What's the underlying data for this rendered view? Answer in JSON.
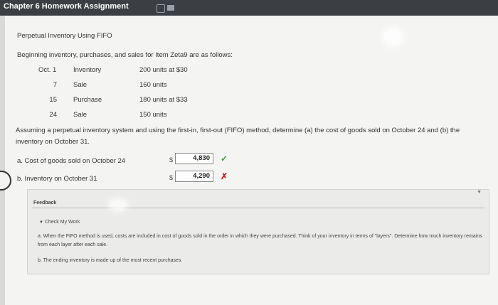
{
  "window": {
    "title": "Chapter 6 Homework Assignment"
  },
  "problem": {
    "heading": "Perpetual Inventory Using FIFO",
    "intro": "Beginning inventory, purchases, and sales for Item Zeta9 are as follows:",
    "transactions": [
      {
        "date": "Oct. 1",
        "type": "Inventory",
        "detail": "200 units at $30"
      },
      {
        "date": "7",
        "type": "Sale",
        "detail": "160 units"
      },
      {
        "date": "15",
        "type": "Purchase",
        "detail": "180 units at $33"
      },
      {
        "date": "24",
        "type": "Sale",
        "detail": "150 units"
      }
    ],
    "question": "Assuming a perpetual inventory system and using the first-in, first-out (FIFO) method, determine (a) the cost of goods sold on October 24 and (b) the inventory on October 31."
  },
  "answers": [
    {
      "label": "a. Cost of goods sold on October 24",
      "currency": "$",
      "value": "4,830",
      "status": "correct"
    },
    {
      "label": "b. Inventory on October 31",
      "currency": "$",
      "value": "4,290",
      "status": "incorrect"
    }
  ],
  "feedback": {
    "header": "Feedback",
    "check_my_work": "Check My Work",
    "hint_a": "a. When the FIFO method is used, costs are included in cost of goods sold in the order in which they were purchased. Think of your inventory in terms of \"layers\". Determine how much inventory remains from each layer after each sale.",
    "hint_b": "b. The ending inventory is made up of the most recent purchases."
  },
  "icons": {
    "correct": "✓",
    "incorrect": "✗",
    "collapse": "▼",
    "expanded": "▼"
  },
  "colors": {
    "topbar": "#3b3f44",
    "correct": "#3a9a3a",
    "incorrect": "#d32020"
  }
}
